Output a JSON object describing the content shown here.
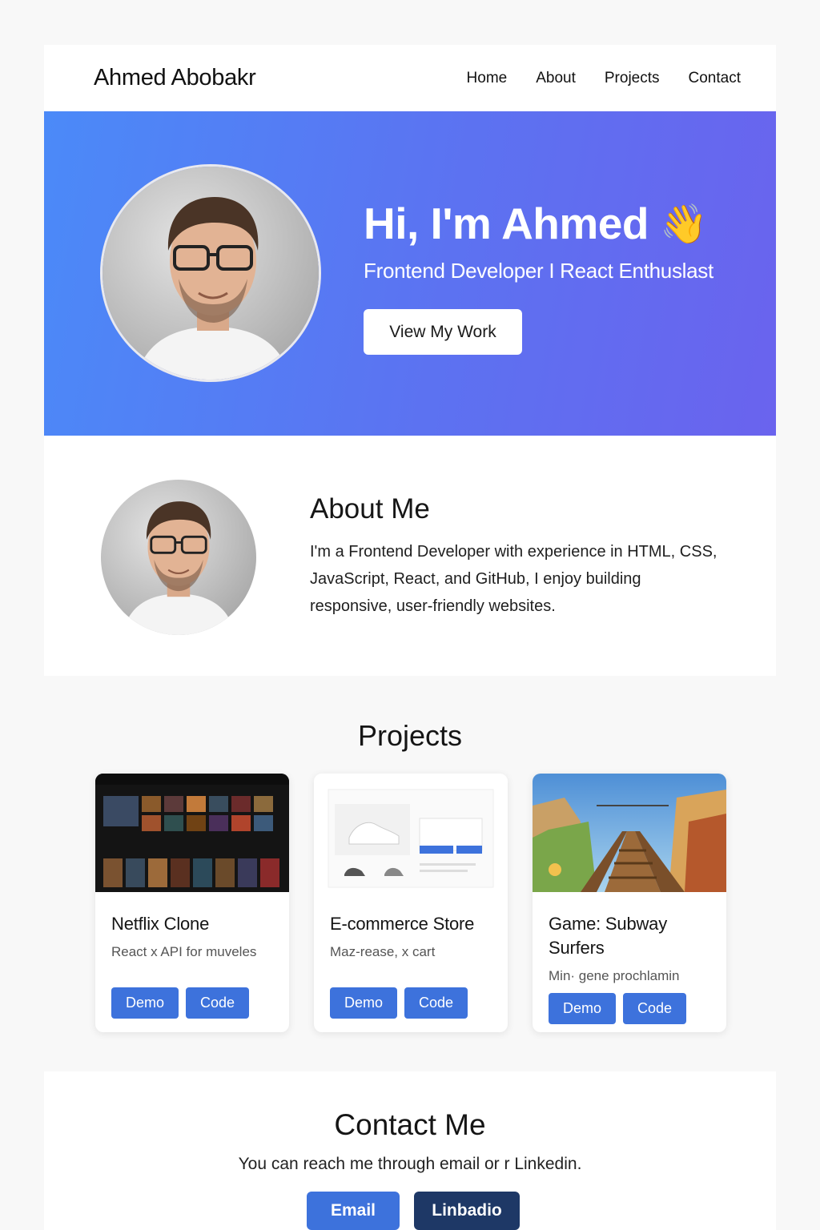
{
  "header": {
    "brand": "Ahmed Abobakr",
    "nav": [
      "Home",
      "About",
      "Projects",
      "Contact"
    ]
  },
  "hero": {
    "title": "Hi, I'm Ahmed",
    "wave_icon": "👋",
    "subtitle": "Frontend Developer I React Enthuslast",
    "cta_label": "View My Work"
  },
  "about": {
    "title": "About Me",
    "body": "I'm a Frontend Developer with experience in HTML, CSS, JavaScript, React, and GitHub, I enjoy building responsive, user-friendly websites."
  },
  "projects": {
    "title": "Projects",
    "items": [
      {
        "title": "Netflix Clone",
        "desc": "React x  API for muveles",
        "demo": "Demo",
        "code": "Code",
        "thumb_icon": "movie-grid-thumbnail"
      },
      {
        "title": "E-commerce Store",
        "desc": "Maz-rease, x cart",
        "demo": "Demo",
        "code": "Code",
        "thumb_icon": "shoe-store-thumbnail"
      },
      {
        "title": "Game: Subway Surfers",
        "desc": "Min· gene prochlamin",
        "demo": "Demo",
        "code": "Code",
        "thumb_icon": "game-scene-thumbnail"
      }
    ]
  },
  "contact": {
    "title": "Contact Me",
    "text": "You can reach me through email or r Linkedin.",
    "email_label": "Email",
    "linkedin_label": "Linbadio"
  },
  "colors": {
    "accent": "#3d72dc",
    "linkedin": "#1e3866",
    "hero_start": "#4b8af8",
    "hero_end": "#6a63ee"
  }
}
